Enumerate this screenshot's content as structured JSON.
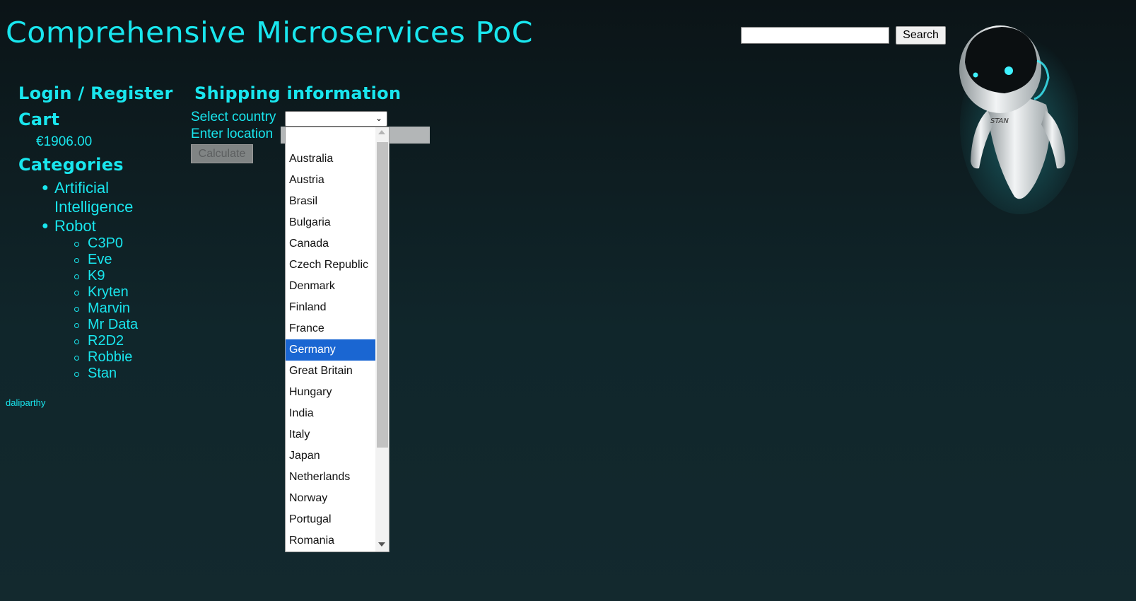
{
  "header": {
    "title": "Comprehensive Microservices PoC",
    "search_placeholder": "",
    "search_button": "Search"
  },
  "sidebar": {
    "login_label": "Login / Register",
    "cart_label": "Cart",
    "cart_total": "€1906.00",
    "categories_label": "Categories",
    "categories": [
      {
        "label": "Artificial Intelligence"
      },
      {
        "label": "Robot",
        "items": [
          "C3P0",
          "Eve",
          "K9",
          "Kryten",
          "Marvin",
          "Mr Data",
          "R2D2",
          "Robbie",
          "Stan"
        ]
      }
    ],
    "footer": "daliparthy"
  },
  "shipping": {
    "title": "Shipping information",
    "select_country_label": "Select country",
    "enter_location_label": "Enter location",
    "calculate_button": "Calculate",
    "selected_country": "",
    "dropdown_options": [
      "",
      "Australia",
      "Austria",
      "Brasil",
      "Bulgaria",
      "Canada",
      "Czech Republic",
      "Denmark",
      "Finland",
      "France",
      "Germany",
      "Great Britain",
      "Hungary",
      "India",
      "Italy",
      "Japan",
      "Netherlands",
      "Norway",
      "Portugal",
      "Romania"
    ],
    "highlighted_option": "Germany",
    "dropdown_scroll_fraction": 0.72
  },
  "robot": {
    "badge_text": "STAN"
  },
  "colors": {
    "accent": "#19e6ee",
    "highlight": "#1a66d2",
    "background": "#0f2226"
  }
}
